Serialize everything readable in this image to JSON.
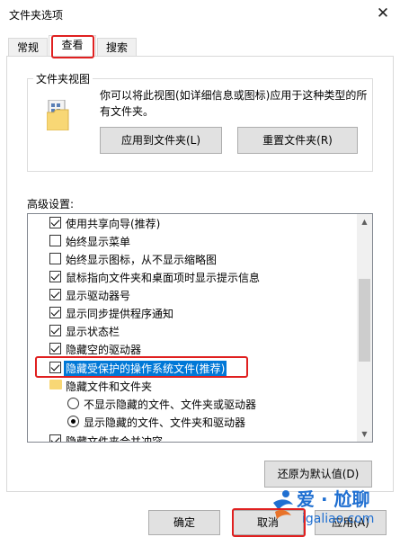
{
  "window": {
    "title": "文件夹选项"
  },
  "tabs": [
    {
      "label": "常规",
      "active": false
    },
    {
      "label": "查看",
      "active": true
    },
    {
      "label": "搜索",
      "active": false
    }
  ],
  "folder_views": {
    "group_label": "文件夹视图",
    "description_line1": "你可以将此视图(如详细信息或图标)应用于这种类型的所",
    "description_line2": "有文件夹。",
    "apply_button": "应用到文件夹(L)",
    "reset_button": "重置文件夹(R)"
  },
  "advanced": {
    "label": "高级设置:",
    "items": [
      {
        "type": "checkbox",
        "label": "使用共享向导(推荐)",
        "checked": true
      },
      {
        "type": "checkbox",
        "label": "始终显示菜单",
        "checked": false
      },
      {
        "type": "checkbox",
        "label": "始终显示图标，从不显示缩略图",
        "checked": false
      },
      {
        "type": "checkbox",
        "label": "鼠标指向文件夹和桌面项时显示提示信息",
        "checked": true
      },
      {
        "type": "checkbox",
        "label": "显示驱动器号",
        "checked": true
      },
      {
        "type": "checkbox",
        "label": "显示同步提供程序通知",
        "checked": true
      },
      {
        "type": "checkbox",
        "label": "显示状态栏",
        "checked": true
      },
      {
        "type": "checkbox",
        "label": "隐藏空的驱动器",
        "checked": true
      },
      {
        "type": "checkbox",
        "label": "隐藏受保护的操作系统文件(推荐)",
        "checked": true,
        "selected": true
      },
      {
        "type": "folder",
        "label": "隐藏文件和文件夹"
      },
      {
        "type": "radio",
        "label": "不显示隐藏的文件、文件夹或驱动器",
        "checked": false
      },
      {
        "type": "radio",
        "label": "显示隐藏的文件、文件夹和驱动器",
        "checked": true
      },
      {
        "type": "checkbox",
        "label": "隐藏文件夹合并冲突",
        "checked": true
      }
    ],
    "restore_button": "还原为默认值(D)"
  },
  "footer": {
    "ok_button": "确定",
    "cancel_button": "取消",
    "apply_button": "应用(A)"
  },
  "watermark": {
    "brand": "爱 · 尬聊",
    "url": "igaliao.com"
  },
  "colors": {
    "highlight": "#0078d7",
    "annotation_red": "#e02020",
    "folder": "#f8d775"
  }
}
